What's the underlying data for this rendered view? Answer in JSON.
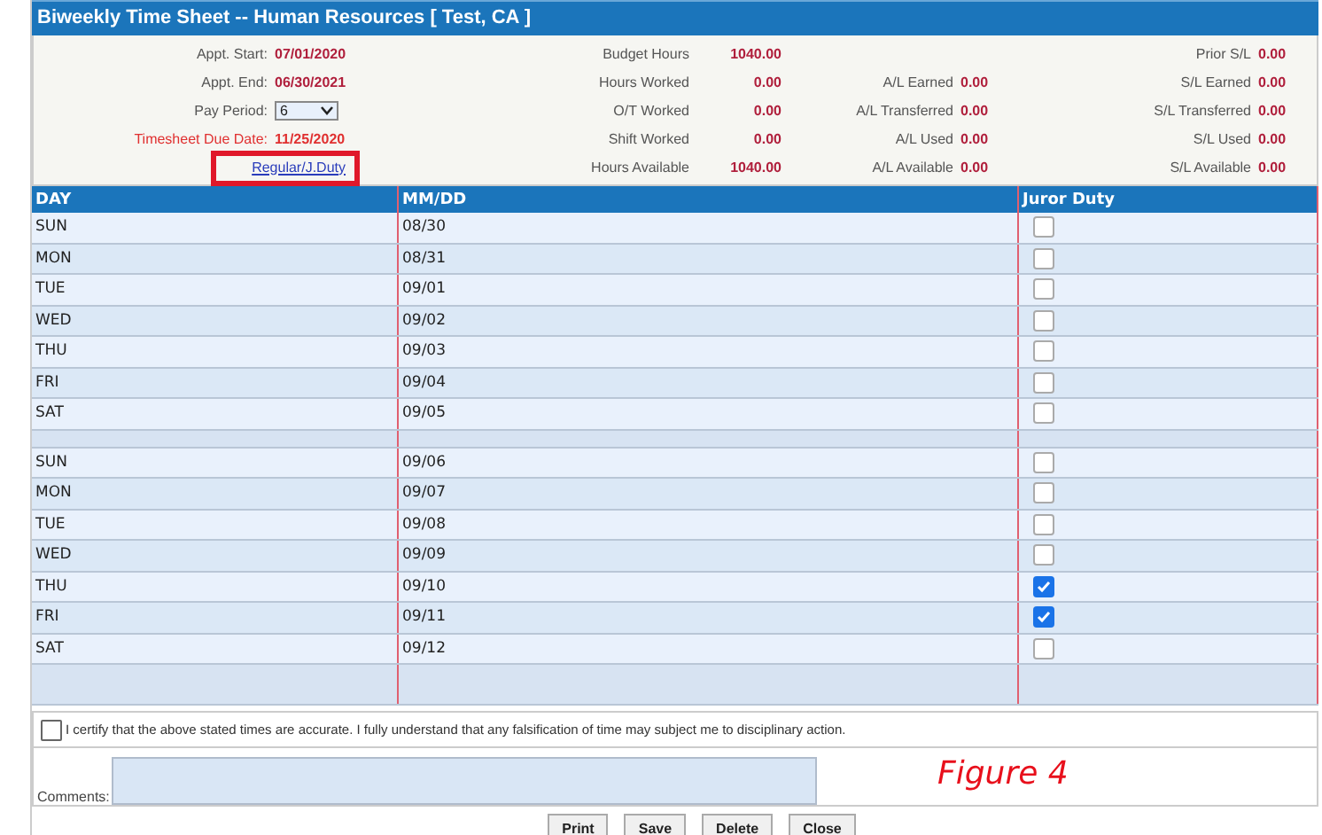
{
  "window": {
    "title": "Biweekly Time Sheet -- Human Resources [ Test, CA ]"
  },
  "info": {
    "appt_start": {
      "label": "Appt. Start:",
      "value": "07/01/2020"
    },
    "appt_end": {
      "label": "Appt. End:",
      "value": "06/30/2021"
    },
    "pay_period": {
      "label": "Pay Period:",
      "value": "6"
    },
    "due_date": {
      "label": "Timesheet Due Date:",
      "value": "11/25/2020"
    },
    "link": "Regular/J.Duty"
  },
  "hours": [
    {
      "label": "Budget Hours",
      "value": "1040.00"
    },
    {
      "label": "Hours Worked",
      "value": "0.00"
    },
    {
      "label": "O/T Worked",
      "value": "0.00"
    },
    {
      "label": "Shift Worked",
      "value": "0.00"
    },
    {
      "label": "Hours Available",
      "value": "1040.00"
    }
  ],
  "annual_leave": [
    {
      "label": "A/L Earned",
      "value": "0.00"
    },
    {
      "label": "A/L Transferred",
      "value": "0.00"
    },
    {
      "label": "A/L Used",
      "value": "0.00"
    },
    {
      "label": "A/L Available",
      "value": "0.00"
    }
  ],
  "sick_leave": [
    {
      "label": "Prior S/L",
      "value": "0.00"
    },
    {
      "label": "S/L Earned",
      "value": "0.00"
    },
    {
      "label": "S/L Transferred",
      "value": "0.00"
    },
    {
      "label": "S/L Used",
      "value": "0.00"
    },
    {
      "label": "S/L Available",
      "value": "0.00"
    }
  ],
  "table": {
    "columns": [
      "DAY",
      "MM/DD",
      "Juror Duty"
    ],
    "weeks": [
      [
        {
          "day": "SUN",
          "date": "08/30",
          "juror_duty": false
        },
        {
          "day": "MON",
          "date": "08/31",
          "juror_duty": false
        },
        {
          "day": "TUE",
          "date": "09/01",
          "juror_duty": false
        },
        {
          "day": "WED",
          "date": "09/02",
          "juror_duty": false
        },
        {
          "day": "THU",
          "date": "09/03",
          "juror_duty": false
        },
        {
          "day": "FRI",
          "date": "09/04",
          "juror_duty": false
        },
        {
          "day": "SAT",
          "date": "09/05",
          "juror_duty": false
        }
      ],
      [
        {
          "day": "SUN",
          "date": "09/06",
          "juror_duty": false
        },
        {
          "day": "MON",
          "date": "09/07",
          "juror_duty": false
        },
        {
          "day": "TUE",
          "date": "09/08",
          "juror_duty": false
        },
        {
          "day": "WED",
          "date": "09/09",
          "juror_duty": false
        },
        {
          "day": "THU",
          "date": "09/10",
          "juror_duty": true
        },
        {
          "day": "FRI",
          "date": "09/11",
          "juror_duty": true
        },
        {
          "day": "SAT",
          "date": "09/12",
          "juror_duty": false
        }
      ]
    ]
  },
  "certify": {
    "label": "I certify that the above stated times are accurate. I fully understand that any falsification of time may subject me to disciplinary action.",
    "checked": false
  },
  "comments": {
    "label": "Comments:"
  },
  "caption": "Figure 4",
  "buttons": [
    "Print",
    "Save",
    "Delete",
    "Close"
  ]
}
